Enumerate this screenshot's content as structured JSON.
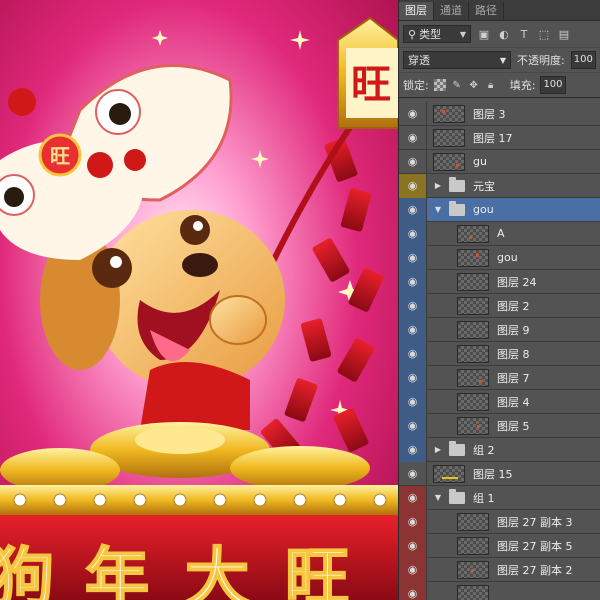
{
  "canvas": {
    "sign_char": "旺",
    "hat_char": "旺",
    "banner_chars": [
      "狗",
      "年",
      "大",
      "旺"
    ]
  },
  "panel": {
    "tabs": [
      {
        "label": "图层",
        "active": true
      },
      {
        "label": "通道",
        "active": false
      },
      {
        "label": "路径",
        "active": false
      }
    ],
    "filter_label": "类型",
    "blend_mode": "穿透",
    "opacity_label": "不透明度:",
    "opacity_value": "100",
    "lock_label": "锁定:",
    "fill_label": "填充:",
    "fill_value": "100"
  },
  "layers": [
    {
      "name": "图层 3",
      "type": "layer",
      "color": "none",
      "indent": 0,
      "thumb": "dot"
    },
    {
      "name": "图层 17",
      "type": "layer",
      "color": "none",
      "indent": 0,
      "thumb": "empty"
    },
    {
      "name": "gu",
      "type": "layer",
      "color": "none",
      "indent": 0,
      "thumb": "dot"
    },
    {
      "name": "元宝",
      "type": "group",
      "color": "yellow",
      "indent": 0,
      "expanded": false
    },
    {
      "name": "gou",
      "type": "group",
      "color": "blue",
      "indent": 0,
      "expanded": true,
      "selected": true
    },
    {
      "name": "A",
      "type": "layer",
      "color": "blue",
      "indent": 1,
      "thumb": "dot"
    },
    {
      "name": "gou",
      "type": "layer",
      "color": "blue",
      "indent": 1,
      "thumb": "dot"
    },
    {
      "name": "图层 24",
      "type": "layer",
      "color": "blue",
      "indent": 1,
      "thumb": "empty"
    },
    {
      "name": "图层 2",
      "type": "layer",
      "color": "blue",
      "indent": 1,
      "thumb": "empty"
    },
    {
      "name": "图层 9",
      "type": "layer",
      "color": "blue",
      "indent": 1,
      "thumb": "empty"
    },
    {
      "name": "图层 8",
      "type": "layer",
      "color": "blue",
      "indent": 1,
      "thumb": "empty"
    },
    {
      "name": "图层 7",
      "type": "layer",
      "color": "blue",
      "indent": 1,
      "thumb": "dot"
    },
    {
      "name": "图层 4",
      "type": "layer",
      "color": "blue",
      "indent": 1,
      "thumb": "empty"
    },
    {
      "name": "图层 5",
      "type": "layer",
      "color": "blue",
      "indent": 1,
      "thumb": "dot"
    },
    {
      "name": "组 2",
      "type": "group",
      "color": "blue",
      "indent": 0,
      "expanded": false
    },
    {
      "name": "图层 15",
      "type": "layer",
      "color": "none",
      "indent": 0,
      "thumb": "line"
    },
    {
      "name": "组 1",
      "type": "group",
      "color": "red",
      "indent": 0,
      "expanded": true
    },
    {
      "name": "图层 27 副本 3",
      "type": "layer",
      "color": "red",
      "indent": 1,
      "thumb": "empty"
    },
    {
      "name": "图层 27 副本 5",
      "type": "layer",
      "color": "red",
      "indent": 1,
      "thumb": "empty"
    },
    {
      "name": "图层 27 副本 2",
      "type": "layer",
      "color": "red",
      "indent": 1,
      "thumb": "dot"
    },
    {
      "name": "",
      "type": "layer",
      "color": "red",
      "indent": 1,
      "thumb": "empty"
    }
  ]
}
